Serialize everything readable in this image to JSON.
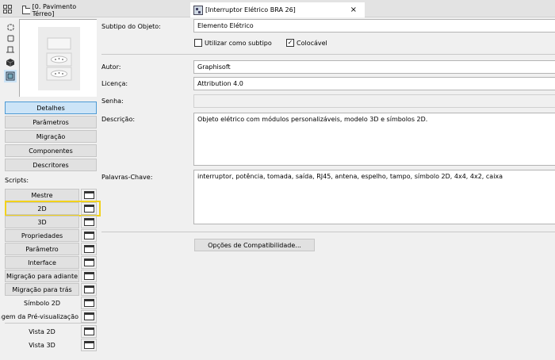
{
  "tabs": [
    {
      "label": "[0. Pavimento Térreo]"
    },
    {
      "label": "[Interruptor Elétrico BRA 26]",
      "close": "×"
    }
  ],
  "sidebar": {
    "icons": [
      "select-icon",
      "rectangle-icon",
      "floor-plan-icon",
      "3d-cube-icon",
      "details-view-icon"
    ],
    "buttons": [
      {
        "label": "Detalhes",
        "selected": true
      },
      {
        "label": "Parâmetros"
      },
      {
        "label": "Migração"
      },
      {
        "label": "Componentes"
      },
      {
        "label": "Descritores"
      }
    ],
    "scripts_label": "Scripts:",
    "scripts": [
      {
        "label": "Mestre"
      },
      {
        "label": "2D",
        "highlighted": true
      },
      {
        "label": "3D"
      },
      {
        "label": "Propriedades"
      },
      {
        "label": "Parâmetro"
      },
      {
        "label": "Interface"
      },
      {
        "label": "Migração para adiante"
      },
      {
        "label": "Migração para trás"
      },
      {
        "label": "Símbolo 2D"
      },
      {
        "label": "Imagem da Pré-visualização"
      }
    ],
    "views": [
      {
        "label": "Vista 2D"
      },
      {
        "label": "Vista 3D"
      }
    ]
  },
  "details": {
    "subtype_label": "Subtipo do Objeto:",
    "subtype_value": "Elemento Elétrico",
    "use_as_subtype_label": "Utilizar como subtipo",
    "use_as_subtype_checked": false,
    "placeable_label": "Colocável",
    "placeable_checked": true,
    "check_mark": "✓",
    "author_label": "Autor:",
    "author_value": "Graphisoft",
    "license_label": "Licença:",
    "license_value": "Attribution 4.0",
    "password_label": "Senha:",
    "password_value": "",
    "description_label": "Descrição:",
    "description_value": "Objeto elétrico com módulos personalizáveis, modelo 3D e símbolos 2D.",
    "keywords_label": "Palavras-Chave:",
    "keywords_value": "interruptor, potência, tomada, saída, RJ45, antena, espelho, tampo, símbolo 2D, 4x4, 4x2, caixa",
    "compat_button": "Opções de Compatibilidade..."
  },
  "colors": {
    "highlight": "#f2d21b",
    "selected": "#cce4f7"
  }
}
